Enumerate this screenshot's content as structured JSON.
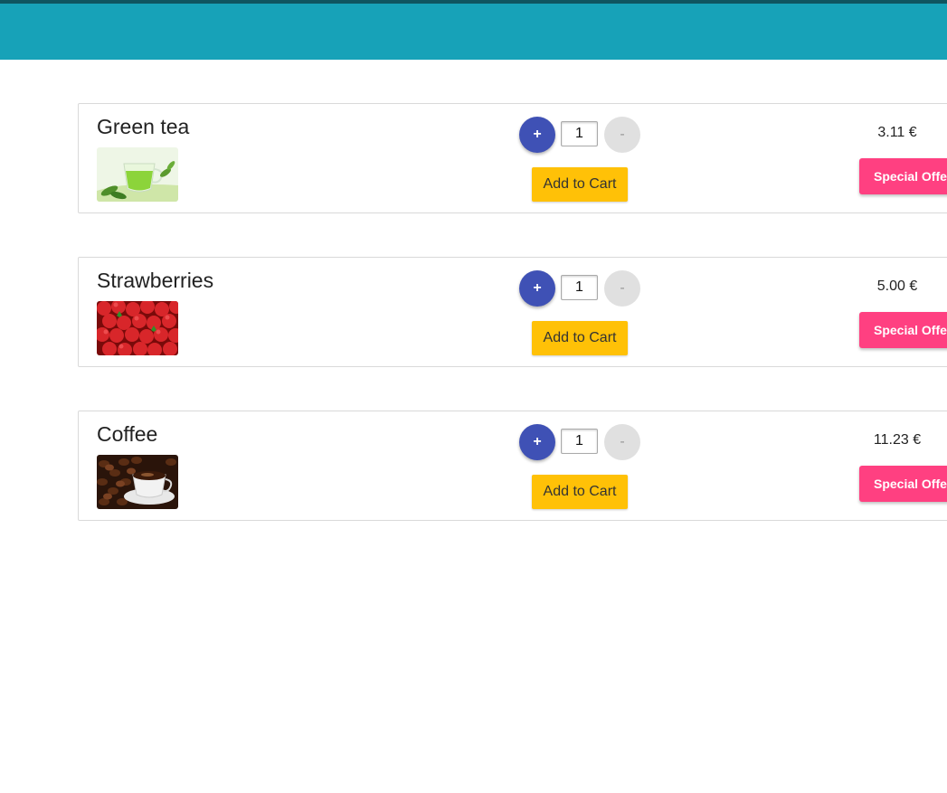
{
  "header": {
    "color": "#17a2b8"
  },
  "products": [
    {
      "name": "Green tea",
      "image_icon": "green-tea-image",
      "quantity": "1",
      "plus_label": "+",
      "minus_label": "-",
      "add_to_cart_label": "Add to Cart",
      "price": "3.11 €",
      "offer_label": "Special Offer"
    },
    {
      "name": "Strawberries",
      "image_icon": "strawberries-image",
      "quantity": "1",
      "plus_label": "+",
      "minus_label": "-",
      "add_to_cart_label": "Add to Cart",
      "price": "5.00 €",
      "offer_label": "Special Offer"
    },
    {
      "name": "Coffee",
      "image_icon": "coffee-image",
      "quantity": "1",
      "plus_label": "+",
      "minus_label": "-",
      "add_to_cart_label": "Add to Cart",
      "price": "11.23 €",
      "offer_label": "Special Offer"
    }
  ],
  "colors": {
    "plus_button": "#3f51b5",
    "minus_button": "#e0e0e0",
    "add_to_cart": "#ffc107",
    "special_offer": "#ff4081"
  }
}
